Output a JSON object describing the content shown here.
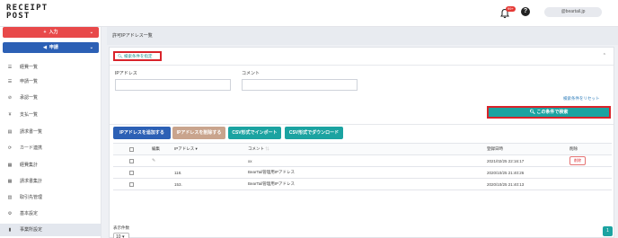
{
  "header": {
    "logo": "RECEIPT\nPOST",
    "logo_line1": "RECEIPT",
    "logo_line2": "POST",
    "notification_badge": "99+",
    "help_icon": "question-icon",
    "user_name": "@beartail.jp"
  },
  "sidebar": {
    "input_button": "入力",
    "apply_button": "申請",
    "items": [
      {
        "label": "経費一覧",
        "icon": "list-icon"
      },
      {
        "label": "申請一覧",
        "icon": "list-icon"
      },
      {
        "label": "承認一覧",
        "icon": "check-circle-icon"
      },
      {
        "label": "支払一覧",
        "icon": "yen-icon"
      },
      {
        "label": "請求書一覧",
        "icon": "document-icon"
      },
      {
        "label": "カード連携",
        "icon": "link-icon"
      },
      {
        "label": "経費集計",
        "icon": "chart-icon"
      },
      {
        "label": "請求書集計",
        "icon": "chart-icon"
      },
      {
        "label": "取引先管理",
        "icon": "building-icon"
      },
      {
        "label": "基本設定",
        "icon": "gear-icon"
      },
      {
        "label": "事業所設定",
        "icon": "office-icon"
      }
    ]
  },
  "main": {
    "title": "許可IPアドレス一覧",
    "search_toggle": "検索条件を指定",
    "filters": {
      "ip_label": "IPアドレス",
      "comment_label": "コメント",
      "reset": "検索条件をリセット",
      "search_button": "この条件で検索"
    },
    "actions": {
      "add": "IPアドレスを追加する",
      "delete": "IPアドレスを削除する",
      "import": "CSV形式でインポート",
      "download": "CSV形式でダウンロード"
    },
    "table": {
      "headers": [
        "",
        "編集",
        "IPアドレス",
        "コメント",
        "登録日時",
        "削除"
      ],
      "rows": [
        {
          "ip": "",
          "comment": "xx",
          "date": "2021/02/25 22:16:17",
          "delete": "削除"
        },
        {
          "ip": "118.",
          "comment": "BearTail管理用IPアドレス",
          "date": "2020/10/25 21:40:26",
          "delete": ""
        },
        {
          "ip": "153.",
          "comment": "BearTail管理用IPアドレス",
          "date": "2020/10/25 21:40:13",
          "delete": ""
        }
      ]
    },
    "per_page_label": "表示件数",
    "per_page_value": "10",
    "page": "1"
  },
  "colors": {
    "input_button": "#e8494a",
    "apply_button": "#2c60b5",
    "teal": "#1ba3a1",
    "highlight": "#d9232a"
  }
}
